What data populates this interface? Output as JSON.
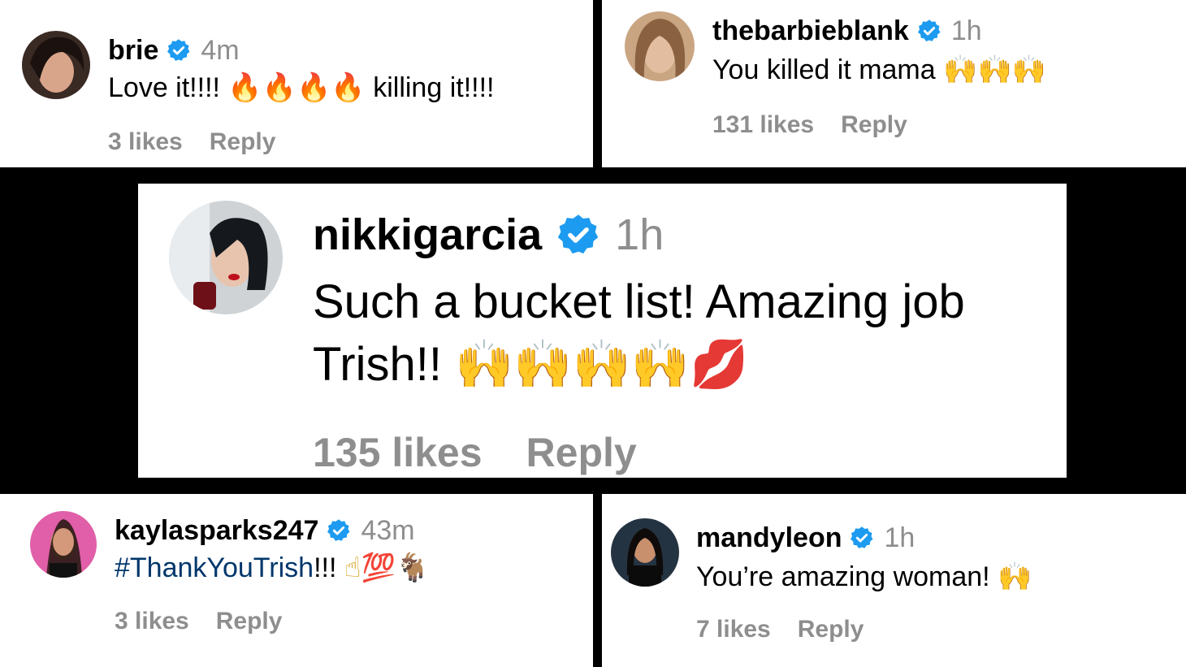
{
  "comments": {
    "brie": {
      "username": "brie",
      "time": "4m",
      "text": "Love it!!!!",
      "emoji1": "🔥🔥🔥🔥",
      "text2": "killing it!!!!",
      "likes": "3 likes",
      "reply": "Reply"
    },
    "barbie": {
      "username": "thebarbieblank",
      "time": "1h",
      "text": "You killed it mama",
      "emoji1": "🙌🙌🙌",
      "likes": "131 likes",
      "reply": "Reply"
    },
    "nikki": {
      "username": "nikkigarcia",
      "time": "1h",
      "text": "Such a bucket list! Amazing job",
      "text2": "Trish!!",
      "emoji1": "🙌🙌🙌🙌",
      "emoji2": "💋",
      "likes": "135 likes",
      "reply": "Reply"
    },
    "kayla": {
      "username": "kaylasparks247",
      "time": "43m",
      "hashtag": "#ThankYouTrish",
      "text": "!!!",
      "emoji1": "☝💯🐐",
      "likes": "3 likes",
      "reply": "Reply"
    },
    "mandy": {
      "username": "mandyleon",
      "time": "1h",
      "text": "You’re amazing woman!",
      "emoji1": "🙌",
      "likes": "7 likes",
      "reply": "Reply"
    }
  },
  "colors": {
    "verified": "#1d9bf0",
    "meta": "#8e8e8e",
    "background": "#000000"
  }
}
